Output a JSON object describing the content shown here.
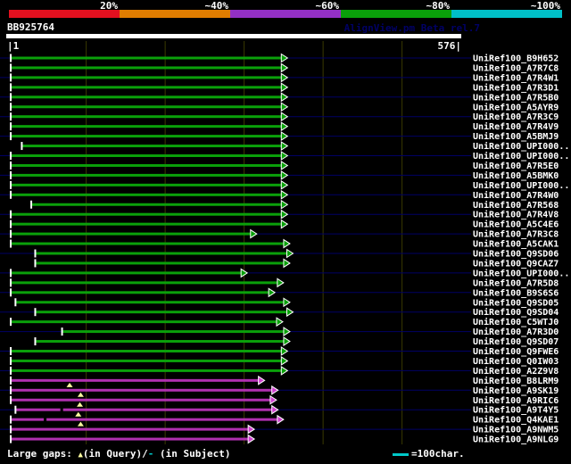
{
  "page": {
    "background": "#000000"
  },
  "scale_bar": {
    "segments": [
      {
        "label": "20%",
        "color": "#e3101f"
      },
      {
        "label": "~40%",
        "color": "#e07d00"
      },
      {
        "label": "~60%",
        "color": "#9330c4"
      },
      {
        "label": "~80%",
        "color": "#0aa00a"
      },
      {
        "label": "~100%",
        "color": "#00c0c8"
      }
    ]
  },
  "header": {
    "query_name": "BB925764",
    "app_version": "AlignView.pm Beta rel.7",
    "version_color": "#000066"
  },
  "ruler": {
    "start_label": "|1",
    "end_label": "576|"
  },
  "legend": {
    "gaps_prefix": "Large gaps: ",
    "query_gap_symbol": "▲",
    "query_gap_text": "(in Query)/",
    "subject_gap_symbol": "-",
    "subject_gap_text": " (in Subject)",
    "query_gap_color": "#ffffa0",
    "subject_gap_color": "#00c8c8",
    "scale_line_label": "=100char.",
    "scale_line_color": "#00c8c8"
  },
  "chart_data": {
    "type": "bar",
    "title": "BB925764",
    "x_axis": {
      "min": 1,
      "max": 576,
      "tick_interval_chars": 100
    },
    "gridline_color": "#3a3a00",
    "connector_color": "#000066",
    "palette": {
      "green": {
        "bar": "#0aa00a",
        "arrow": "#0aa00a"
      },
      "magenta": {
        "bar": "#b030b0",
        "arrow": "#cf42cf"
      }
    },
    "rows": [
      {
        "label": "UniRef100_B9H652",
        "color": "green",
        "start": 5,
        "end": 355
      },
      {
        "label": "UniRef100_A7R7C8",
        "color": "green",
        "start": 5,
        "end": 355
      },
      {
        "label": "UniRef100_A7R4W1",
        "color": "green",
        "start": 5,
        "end": 355
      },
      {
        "label": "UniRef100_A7R3D1",
        "color": "green",
        "start": 5,
        "end": 355
      },
      {
        "label": "UniRef100_A7R5B0",
        "color": "green",
        "start": 5,
        "end": 355
      },
      {
        "label": "UniRef100_A5AYR9",
        "color": "green",
        "start": 5,
        "end": 355
      },
      {
        "label": "UniRef100_A7R3C9",
        "color": "green",
        "start": 5,
        "end": 355
      },
      {
        "label": "UniRef100_A7R4V9",
        "color": "green",
        "start": 5,
        "end": 355
      },
      {
        "label": "UniRef100_A5BMJ9",
        "color": "green",
        "start": 5,
        "end": 355
      },
      {
        "label": "UniRef100_UPI000..",
        "color": "green",
        "start": 19,
        "end": 355
      },
      {
        "label": "UniRef100_UPI000..",
        "color": "green",
        "start": 5,
        "end": 355
      },
      {
        "label": "UniRef100_A7R5E0",
        "color": "green",
        "start": 5,
        "end": 355
      },
      {
        "label": "UniRef100_A5BMK0",
        "color": "green",
        "start": 5,
        "end": 355
      },
      {
        "label": "UniRef100_UPI000..",
        "color": "green",
        "start": 5,
        "end": 355
      },
      {
        "label": "UniRef100_A7R4W0",
        "color": "green",
        "start": 5,
        "end": 355
      },
      {
        "label": "UniRef100_A7R568",
        "color": "green",
        "start": 31,
        "end": 355
      },
      {
        "label": "UniRef100_A7R4V8",
        "color": "green",
        "start": 5,
        "end": 355
      },
      {
        "label": "UniRef100_A5C4E6",
        "color": "green",
        "start": 5,
        "end": 355
      },
      {
        "label": "UniRef100_A7R3C8",
        "color": "green",
        "start": 5,
        "end": 316
      },
      {
        "label": "UniRef100_A5CAK1",
        "color": "green",
        "start": 5,
        "end": 358
      },
      {
        "label": "UniRef100_Q9SD06",
        "color": "green",
        "start": 36,
        "end": 362
      },
      {
        "label": "UniRef100_Q9CAZ7",
        "color": "green",
        "start": 36,
        "end": 358
      },
      {
        "label": "UniRef100_UPI000..",
        "color": "green",
        "start": 5,
        "end": 304
      },
      {
        "label": "UniRef100_A7R5D8",
        "color": "green",
        "start": 5,
        "end": 350
      },
      {
        "label": "UniRef100_B9S6S6",
        "color": "green",
        "start": 5,
        "end": 339
      },
      {
        "label": "UniRef100_Q9SD05",
        "color": "green",
        "start": 11,
        "end": 358
      },
      {
        "label": "UniRef100_Q9SD04",
        "color": "green",
        "start": 36,
        "end": 362
      },
      {
        "label": "UniRef100_C5WTJ0",
        "color": "green",
        "start": 5,
        "end": 349
      },
      {
        "label": "UniRef100_A7R3D0",
        "color": "green",
        "start": 70,
        "end": 358
      },
      {
        "label": "UniRef100_Q9SD07",
        "color": "green",
        "start": 36,
        "end": 358
      },
      {
        "label": "UniRef100_Q9FWE6",
        "color": "green",
        "start": 5,
        "end": 355
      },
      {
        "label": "UniRef100_Q0IW03",
        "color": "green",
        "start": 5,
        "end": 355
      },
      {
        "label": "UniRef100_A2Z9V8",
        "color": "green",
        "start": 5,
        "end": 355
      },
      {
        "label": "UniRef100_B8LRM9",
        "color": "magenta",
        "start": 5,
        "end": 326,
        "query_gaps": [
          79
        ]
      },
      {
        "label": "UniRef100_A9SK19",
        "color": "magenta",
        "start": 5,
        "end": 343,
        "query_gaps": [
          93
        ]
      },
      {
        "label": "UniRef100_A9RIC6",
        "color": "magenta",
        "start": 5,
        "end": 341,
        "query_gaps": [
          92
        ]
      },
      {
        "label": "UniRef100_A9T4Y5",
        "color": "magenta",
        "start": 11,
        "end": 343,
        "query_gaps": [
          90
        ],
        "subject_gaps": [
          69
        ]
      },
      {
        "label": "UniRef100_Q4KAE1",
        "color": "magenta",
        "start": 5,
        "end": 350,
        "query_gaps": [
          93
        ],
        "subject_gaps": [
          48
        ]
      },
      {
        "label": "UniRef100_A9NWM5",
        "color": "magenta",
        "start": 5,
        "end": 313
      },
      {
        "label": "UniRef100_A9NLG9",
        "color": "magenta",
        "start": 5,
        "end": 313
      }
    ]
  }
}
